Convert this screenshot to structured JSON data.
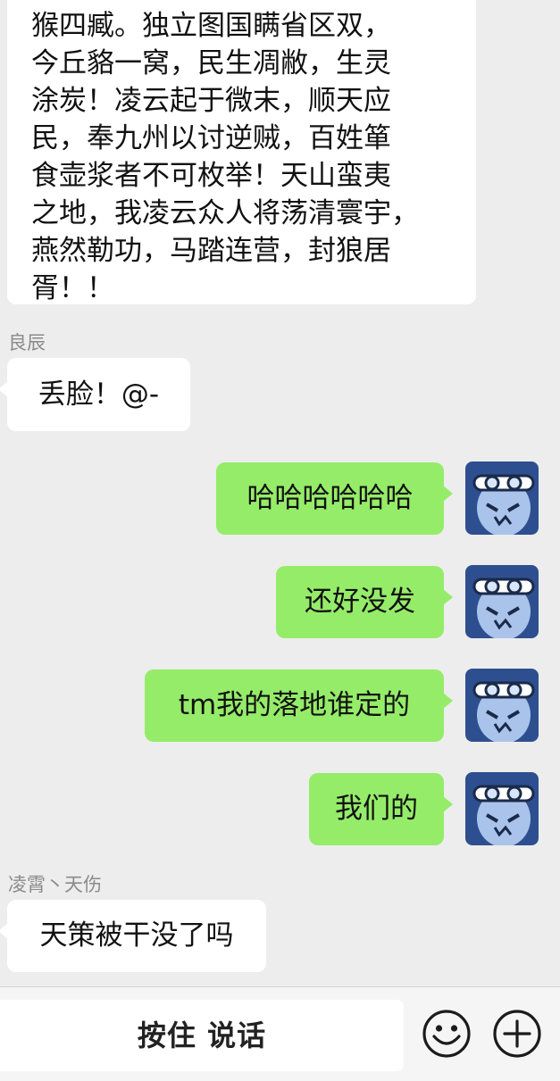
{
  "messages": {
    "long_text": {
      "lines": [
        "猴四臧。独立图国瞒省区双，",
        "今丘貉一窝，民生凋敝，生灵",
        "涂炭！凌云起于微末，顺天应",
        "民，奉九州以讨逆贼，百姓箪",
        "食壶浆者不可枚举！天山蛮夷",
        "之地，我凌云众人将荡清寰宇，",
        "燕然勒功，马踏连营，封狼居",
        "胥！！"
      ]
    },
    "sender_1": "良辰",
    "msg_1": "丢脸！@-",
    "msg_2": "哈哈哈哈哈哈",
    "msg_3": "还好没发",
    "msg_4": "tm我的落地谁定的",
    "msg_5": "我们的",
    "sender_2": "凌霄丶天伤",
    "msg_6": "天策被干没了吗"
  },
  "input_bar": {
    "hold_to_talk": "按住 说话",
    "emoji_icon": "emoji-icon",
    "add_icon": "plus-circle-icon"
  },
  "colors": {
    "background": "#ededed",
    "bubble_self": "#95ec69",
    "bubble_other": "#ffffff",
    "sender_name": "#8a8a8a"
  }
}
